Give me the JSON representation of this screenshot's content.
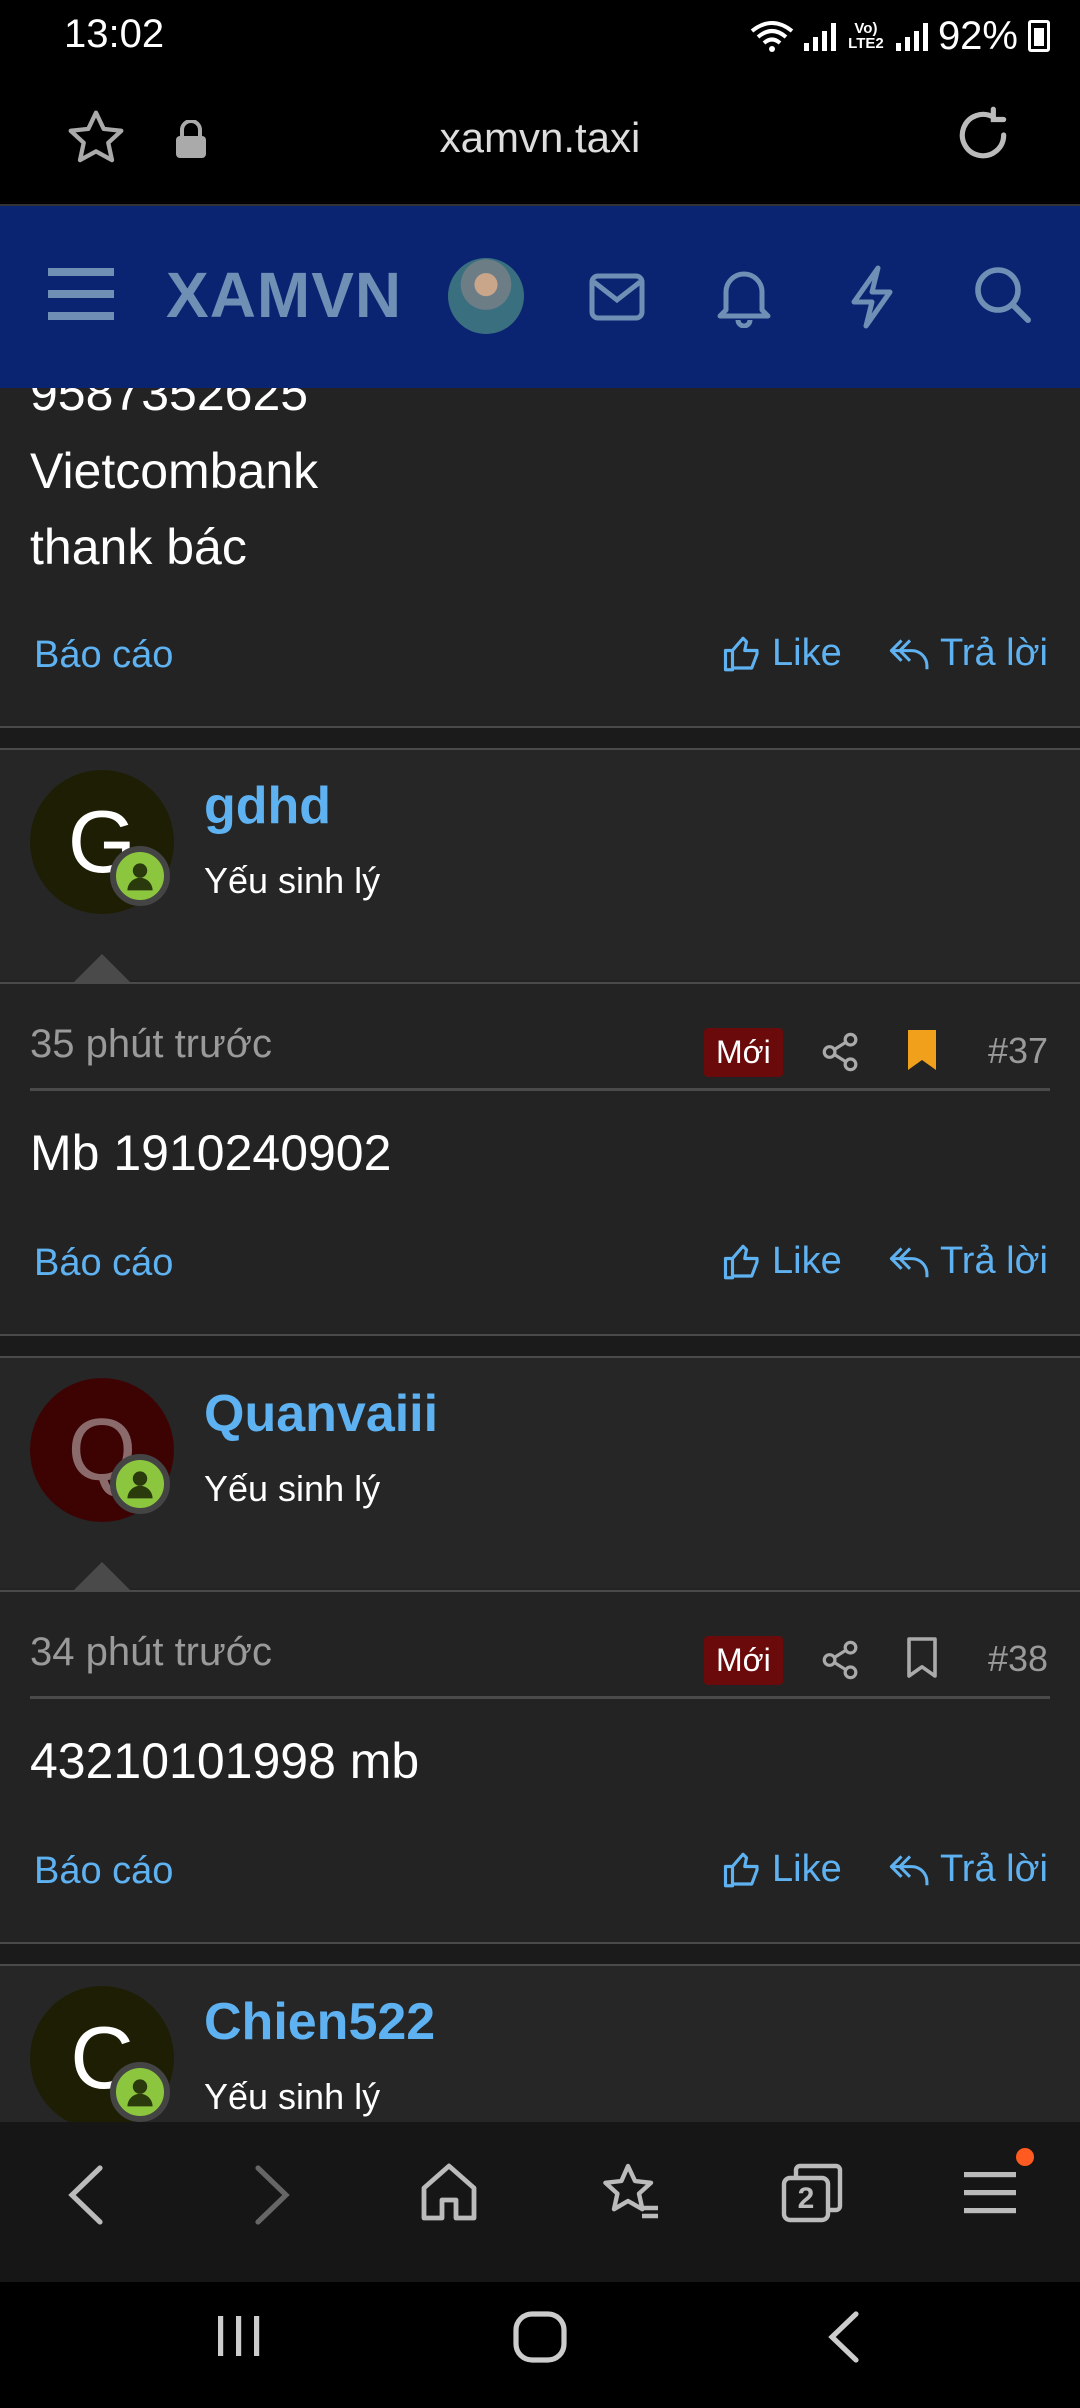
{
  "status_bar": {
    "time": "13:02",
    "battery": "92%",
    "network_label": "Vo) LTE2"
  },
  "browser": {
    "url": "xamvn.taxi",
    "tab_count": "2"
  },
  "site": {
    "logo": "XAMVN"
  },
  "previous_post": {
    "lines": [
      "9587352625",
      "Vietcombank",
      "thank bác"
    ],
    "report": "Báo cáo",
    "like": "Like",
    "reply": "Trả lời"
  },
  "posts": [
    {
      "avatar_letter": "G",
      "username": "gdhd",
      "user_title": "Yếu sinh lý",
      "time": "35 phút trước",
      "badge": "Mới",
      "number": "#37",
      "bookmarked": true,
      "body": "Mb 1910240902",
      "report": "Báo cáo",
      "like": "Like",
      "reply": "Trả lời"
    },
    {
      "avatar_letter": "Q",
      "username": "Quanvaiii",
      "user_title": "Yếu sinh lý",
      "time": "34 phút trước",
      "badge": "Mới",
      "number": "#38",
      "bookmarked": false,
      "body": "43210101998 mb",
      "report": "Báo cáo",
      "like": "Like",
      "reply": "Trả lời"
    },
    {
      "avatar_letter": "C",
      "username": "Chien522",
      "user_title": "Yếu sinh lý"
    }
  ],
  "colors": {
    "header_bg": "#0a2472",
    "link": "#5fb2f1",
    "badge_bg": "#6b0a0a",
    "bookmark_active": "#f0a01a",
    "online": "#8cc63f"
  }
}
